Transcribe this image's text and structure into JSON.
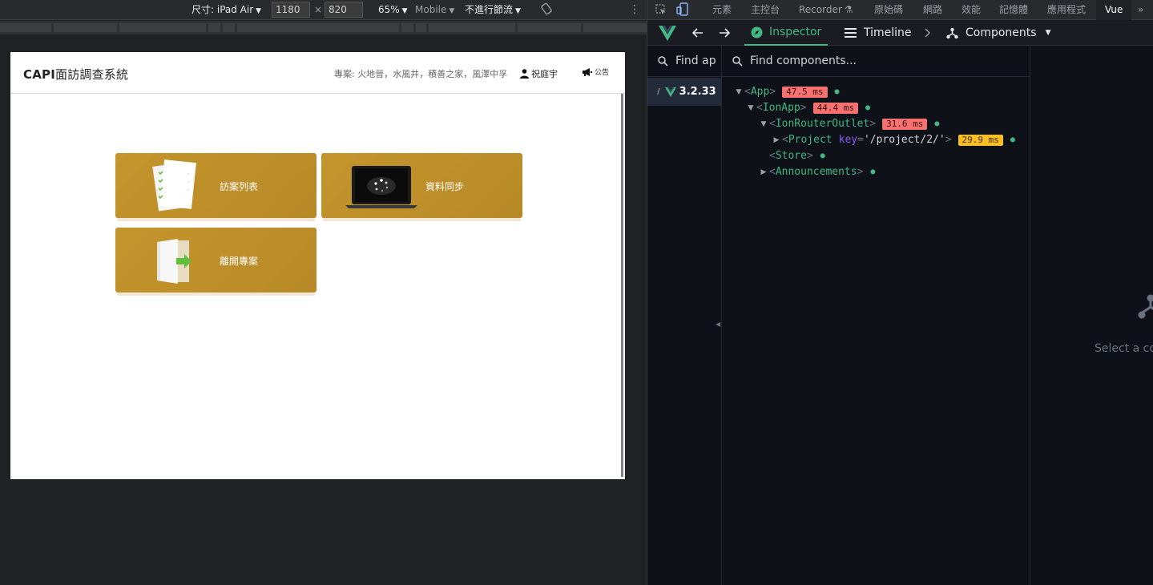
{
  "emulation_toolbar": {
    "dimensions_label": "尺寸: iPad Air",
    "width_value": "1180",
    "times": "×",
    "height_value": "820",
    "zoom": "65%",
    "mode": "Mobile",
    "throttle": "不進行節流",
    "more": "⋮"
  },
  "app": {
    "title_bold": "CAPI",
    "title_rest": "面訪調查系統",
    "projects": "專案: 火地晉，水風井，積善之家，風澤中孚",
    "user": "祝庭宇",
    "notice": "公告",
    "cards": [
      {
        "label": "訪案列表",
        "icon": "documents-icon"
      },
      {
        "label": "資料同步",
        "icon": "laptop-sync-icon"
      },
      {
        "label": "離開專案",
        "icon": "exit-door-icon"
      }
    ]
  },
  "devtools": {
    "tabs": [
      "元素",
      "主控台",
      "Recorder",
      "原始碼",
      "網路",
      "效能",
      "記憶體",
      "應用程式",
      "Vue"
    ],
    "active_tab": "Vue",
    "more": "»",
    "vue_nav": {
      "inspector": "Inspector",
      "timeline": "Timeline",
      "components": "Components"
    },
    "apps_search_placeholder": "Find ap",
    "components_search_placeholder": "Find components...",
    "app_version": "3.2.33",
    "tree": [
      {
        "name": "App",
        "ms": "47.5 ms",
        "color": "red",
        "level": 0,
        "expanded": true
      },
      {
        "name": "IonApp",
        "ms": "44.4 ms",
        "color": "red",
        "level": 1,
        "expanded": true
      },
      {
        "name": "IonRouterOutlet",
        "ms": "31.6 ms",
        "color": "red",
        "level": 2,
        "expanded": true
      },
      {
        "name": "Project",
        "attr_key": "key",
        "attr_val": "'/project/2/'",
        "ms": "29.9 ms",
        "color": "yellow",
        "level": 3,
        "expanded": false
      },
      {
        "name": "Store",
        "level": 2,
        "expanded": null
      },
      {
        "name": "Announcements",
        "level": 2,
        "expanded": false
      }
    ],
    "select_hint": "Select a co"
  }
}
